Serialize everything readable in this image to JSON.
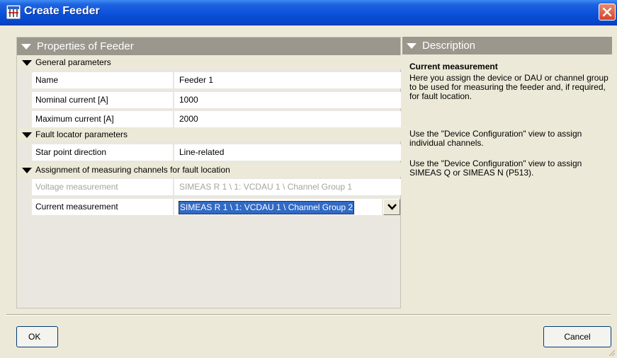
{
  "window": {
    "title": "Create Feeder",
    "close_icon": "close-icon"
  },
  "properties_panel": {
    "header": "Properties of Feeder",
    "groups": [
      {
        "label": "General parameters",
        "rows": [
          {
            "name": "Name",
            "value": "Feeder 1"
          },
          {
            "name": "Nominal current [A]",
            "value": "1000"
          },
          {
            "name": "Maximum current [A]",
            "value": "2000"
          }
        ]
      },
      {
        "label": "Fault locator parameters",
        "rows": [
          {
            "name": "Star point direction",
            "value": "Line-related"
          }
        ]
      },
      {
        "label": "Assignment of measuring channels for fault location",
        "rows": [
          {
            "name": "Voltage measurement",
            "value": "SIMEAS R 1 \\ 1: VCDAU 1 \\ Channel Group 1",
            "disabled": true
          },
          {
            "name": "Current measurement",
            "value": "SIMEAS R 1 \\ 1: VCDAU 1 \\ Channel Group 2",
            "selected": true
          }
        ]
      }
    ]
  },
  "description_panel": {
    "header": "Description",
    "heading": "Current measurement",
    "paragraphs": [
      "Here you assign the device or DAU or channel group to be used for measuring the feeder and, if required, for fault location.",
      "Use the \"Device Configuration\" view to assign individual channels.",
      "Use the \"Device Configuration\" view to assign SIMEAS Q or SIMEAS N (P513)."
    ]
  },
  "buttons": {
    "ok": "OK",
    "cancel": "Cancel"
  },
  "colors": {
    "title_bar": "#0a4fd8",
    "section_header": "#9b978d",
    "selection": "#316ac5",
    "dialog_bg": "#ece9d8"
  }
}
